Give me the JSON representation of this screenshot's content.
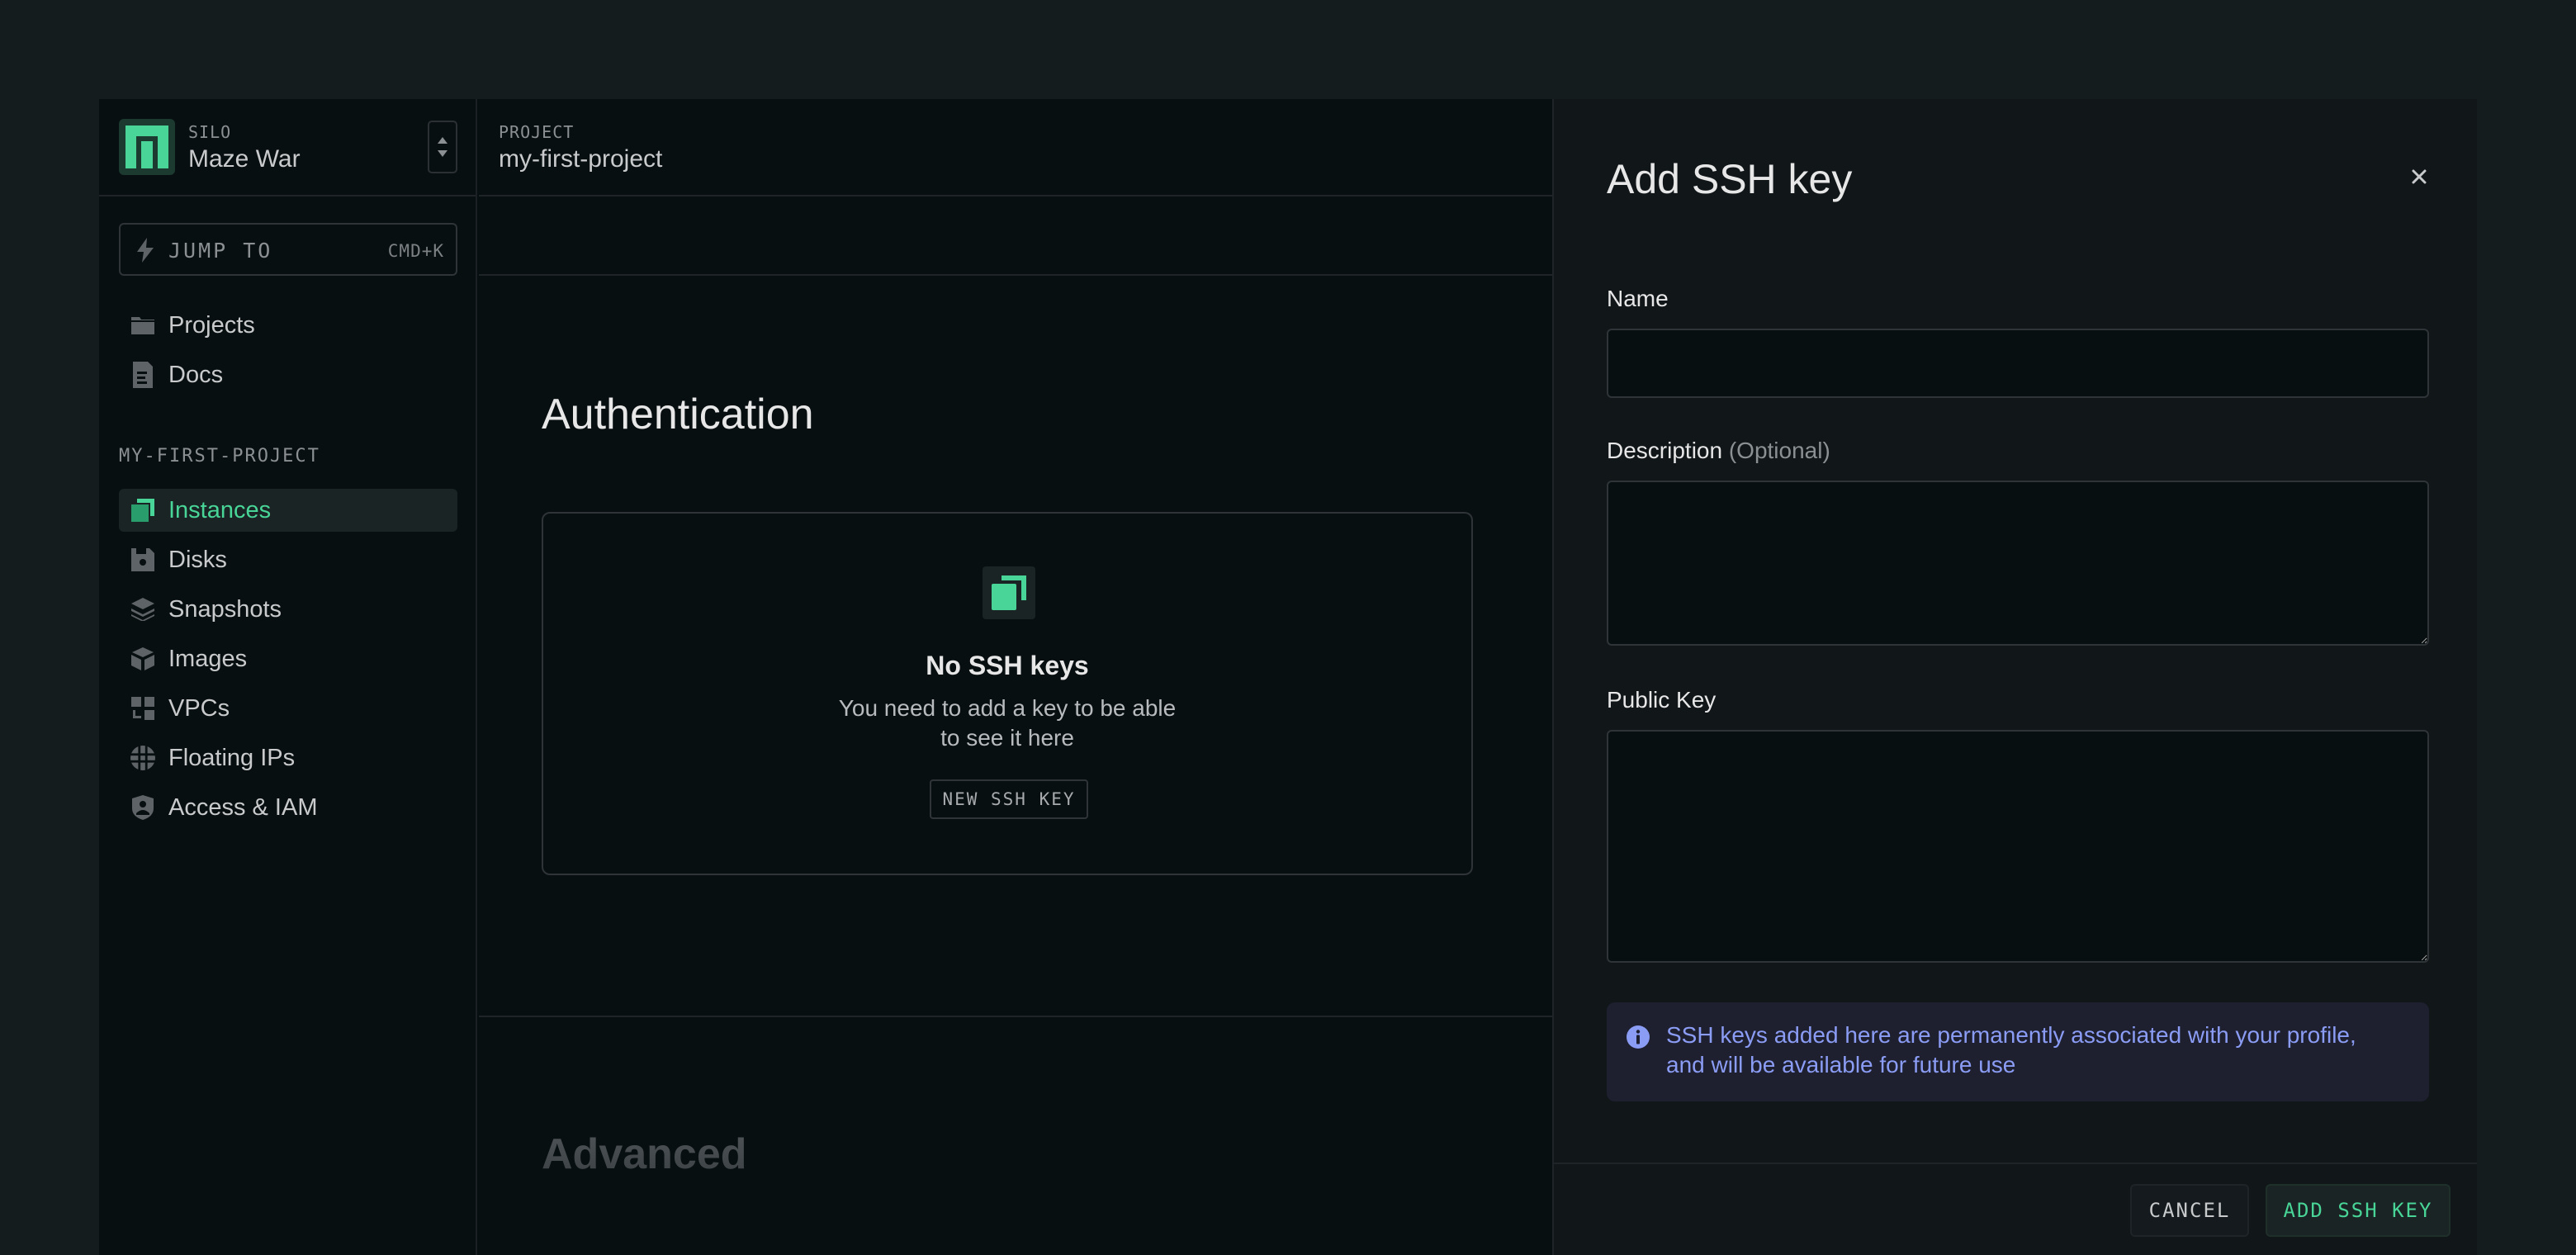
{
  "silo": {
    "kicker": "SILO",
    "name": "Maze War"
  },
  "jump": {
    "label": "JUMP TO",
    "shortcut": "CMD+K"
  },
  "sidebar": {
    "global_items": [
      {
        "label": "Projects",
        "icon": "folder-icon"
      },
      {
        "label": "Docs",
        "icon": "document-icon"
      }
    ],
    "project_heading": "MY-FIRST-PROJECT",
    "project_items": [
      {
        "label": "Instances",
        "icon": "instances-icon",
        "active": true
      },
      {
        "label": "Disks",
        "icon": "disk-icon"
      },
      {
        "label": "Snapshots",
        "icon": "snapshots-icon"
      },
      {
        "label": "Images",
        "icon": "images-icon"
      },
      {
        "label": "VPCs",
        "icon": "vpc-icon"
      },
      {
        "label": "Floating IPs",
        "icon": "globe-icon"
      },
      {
        "label": "Access & IAM",
        "icon": "shield-icon"
      }
    ]
  },
  "topbar": {
    "kicker": "PROJECT",
    "project_name": "my-first-project"
  },
  "main": {
    "section_title": "Authentication",
    "empty_state": {
      "title": "No SSH keys",
      "body": "You need to add a key to be able to see it here",
      "button": "NEW SSH KEY"
    },
    "section_title_2": "Advanced"
  },
  "dialog": {
    "title": "Add SSH key",
    "fields": {
      "name": {
        "label": "Name",
        "value": "",
        "placeholder": ""
      },
      "description": {
        "label": "Description",
        "optional": "(Optional)",
        "value": "",
        "placeholder": ""
      },
      "public_key": {
        "label": "Public Key",
        "value": "",
        "placeholder": ""
      }
    },
    "callout": "SSH keys added here are permanently associated with your profile, and will be available for future use",
    "cancel": "CANCEL",
    "submit": "ADD SSH KEY"
  },
  "colors": {
    "accent": "#48d597",
    "info": "#8b9cf4",
    "background": "#080f11",
    "dialog_background": "#111619"
  }
}
